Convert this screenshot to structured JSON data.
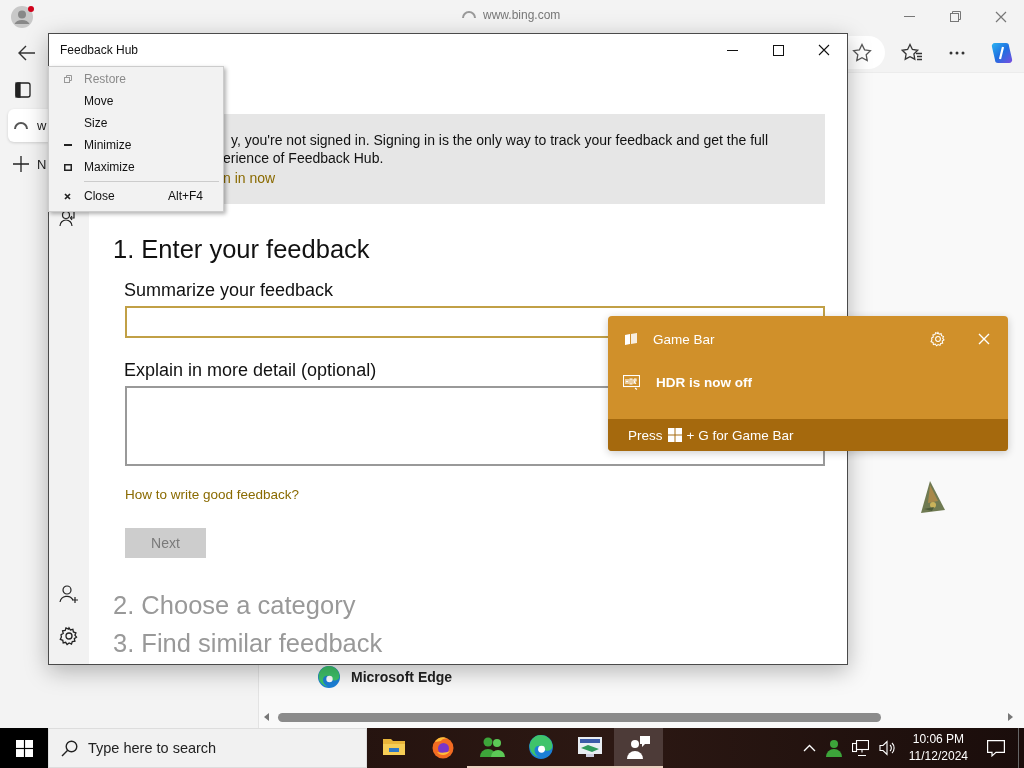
{
  "browser": {
    "title": "www.bing.com",
    "tab_title": "w",
    "new_tab_label": "N",
    "page_label": "Microsoft Edge"
  },
  "feedback_window": {
    "title": "Feedback Hub",
    "banner": {
      "lines": [
        "y, you're not signed in. Signing in is the only way to track your feedback and get the full",
        "erience of Feedback Hub."
      ],
      "link": "n in now"
    },
    "heading": "1. Enter your feedback",
    "summary_field": {
      "label": "Summarize your feedback",
      "focused": true
    },
    "detail_field": {
      "label": "Explain in more detail (optional)",
      "focused": false
    },
    "help_link": "How to write good feedback?",
    "next_button": {
      "label": "Next",
      "disabled": true
    },
    "steps": [
      "2. Choose a category",
      "3. Find similar feedback"
    ]
  },
  "system_menu": {
    "items": [
      {
        "kind": "restore",
        "label": "Restore",
        "disabled": true
      },
      {
        "kind": "move",
        "label": "Move",
        "disabled": false
      },
      {
        "kind": "size",
        "label": "Size",
        "disabled": false
      },
      {
        "kind": "minimize",
        "label": "Minimize",
        "disabled": false
      },
      {
        "kind": "maximize",
        "label": "Maximize",
        "disabled": false
      },
      {
        "kind": "separator"
      },
      {
        "kind": "close",
        "label": "Close",
        "shortcut": "Alt+F4",
        "disabled": false
      }
    ]
  },
  "game_bar": {
    "title": "Game Bar",
    "message": "HDR is now off",
    "hint_before": "Press",
    "hint_after": "+ G for Game Bar"
  },
  "taskbar": {
    "search_placeholder": "Type here to search",
    "apps": [
      {
        "kind": "explorer",
        "running": false,
        "selected": false
      },
      {
        "kind": "firefox",
        "running": false,
        "selected": false
      },
      {
        "kind": "people",
        "running": true,
        "selected": false
      },
      {
        "kind": "edge",
        "running": true,
        "selected": false
      },
      {
        "kind": "monitor",
        "running": true,
        "selected": false
      },
      {
        "kind": "feedback",
        "running": true,
        "selected": true
      }
    ],
    "time": "10:06 PM",
    "date": "11/12/2024"
  }
}
